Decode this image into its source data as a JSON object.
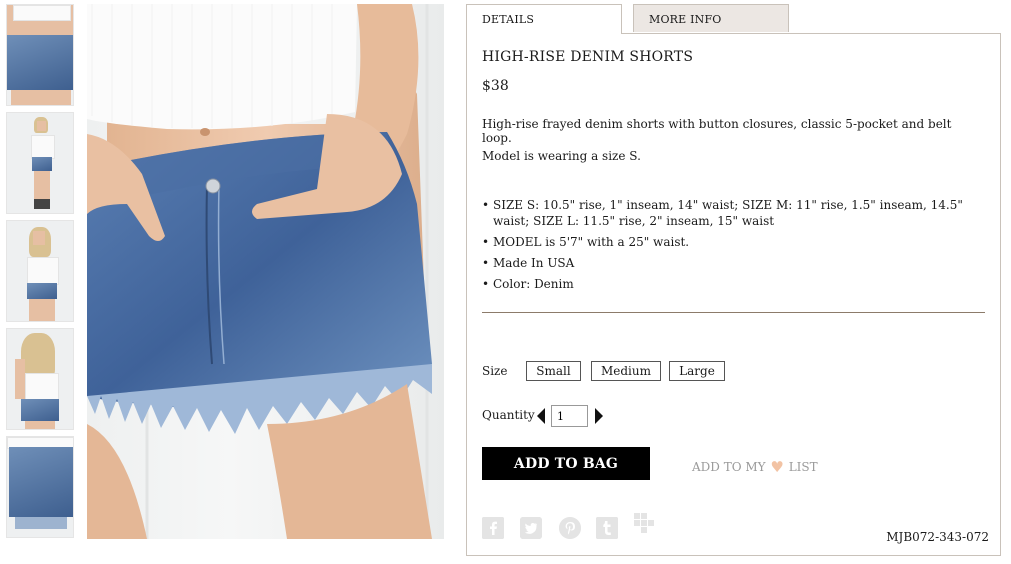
{
  "tabs": {
    "details": "DETAILS",
    "more_info": "MORE INFO"
  },
  "product": {
    "title": "HIGH-RISE DENIM SHORTS",
    "price": "$38",
    "description": "High-rise frayed denim shorts with button closures, classic 5-pocket and belt loop.",
    "model_note": "Model is wearing a size S.",
    "bullets": [
      "SIZE S: 10.5\" rise, 1\" inseam, 14\" waist; SIZE M: 11\" rise, 1.5\" inseam, 14.5\" waist; SIZE L: 11.5\" rise, 2\" inseam, 15\" waist",
      "MODEL is 5'7\" with a 25\" waist.",
      "Made In USA",
      "Color: Denim"
    ],
    "sku": "MJB072-343-072"
  },
  "size": {
    "label": "Size",
    "options": [
      "Small",
      "Medium",
      "Large"
    ]
  },
  "quantity": {
    "label": "Quantity",
    "value": "1"
  },
  "actions": {
    "add_to_bag": "ADD TO BAG",
    "wishlist_prefix": "ADD TO MY",
    "wishlist_suffix": "LIST",
    "heart_color": "#f2c3a4"
  },
  "social": [
    "facebook-icon",
    "twitter-icon",
    "pinterest-icon",
    "tumblr-icon",
    "grid-share-icon"
  ],
  "colors": {
    "tab_inactive": "#ece7e3",
    "border": "#c9c2ba",
    "divider": "#8c7b6a",
    "button_bg": "#000000"
  }
}
